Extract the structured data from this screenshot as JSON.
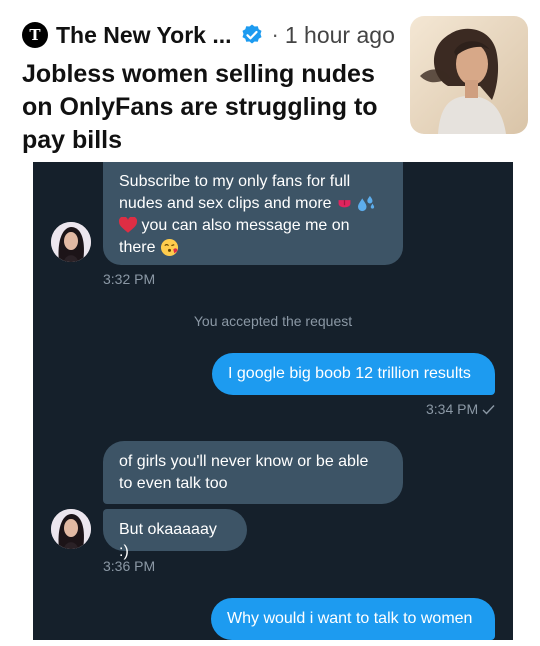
{
  "post": {
    "publisher": "The New York ...",
    "separator": "·",
    "time_ago": "1 hour ago",
    "headline": "Jobless women selling nudes on OnlyFans are struggling to pay bills"
  },
  "chat": {
    "message1": {
      "line1": "Subscribe to my only fans for full",
      "line2": "nudes and sex clips and more",
      "line3": "you can also message me on",
      "line4": "there"
    },
    "time1": "3:32 PM",
    "system_notice": "You accepted the request",
    "message2": "I google big boob 12 trillion results",
    "time2": "3:34 PM",
    "message3": {
      "line1": "of girls you'll never know or be able",
      "line2": "to even talk too"
    },
    "message4": "But okaaaaay :)",
    "time3": "3:36 PM",
    "message5": "Why would i want to talk to women",
    "colors": {
      "background": "#15202b",
      "incoming_bubble": "#3d5466",
      "outgoing_bubble": "#1d9bf0",
      "muted_text": "#8b98a5"
    },
    "icons": [
      "tongue-emoji",
      "sweat-droplets-emoji",
      "red-heart-emoji",
      "kiss-face-emoji",
      "checkmark-icon"
    ]
  }
}
